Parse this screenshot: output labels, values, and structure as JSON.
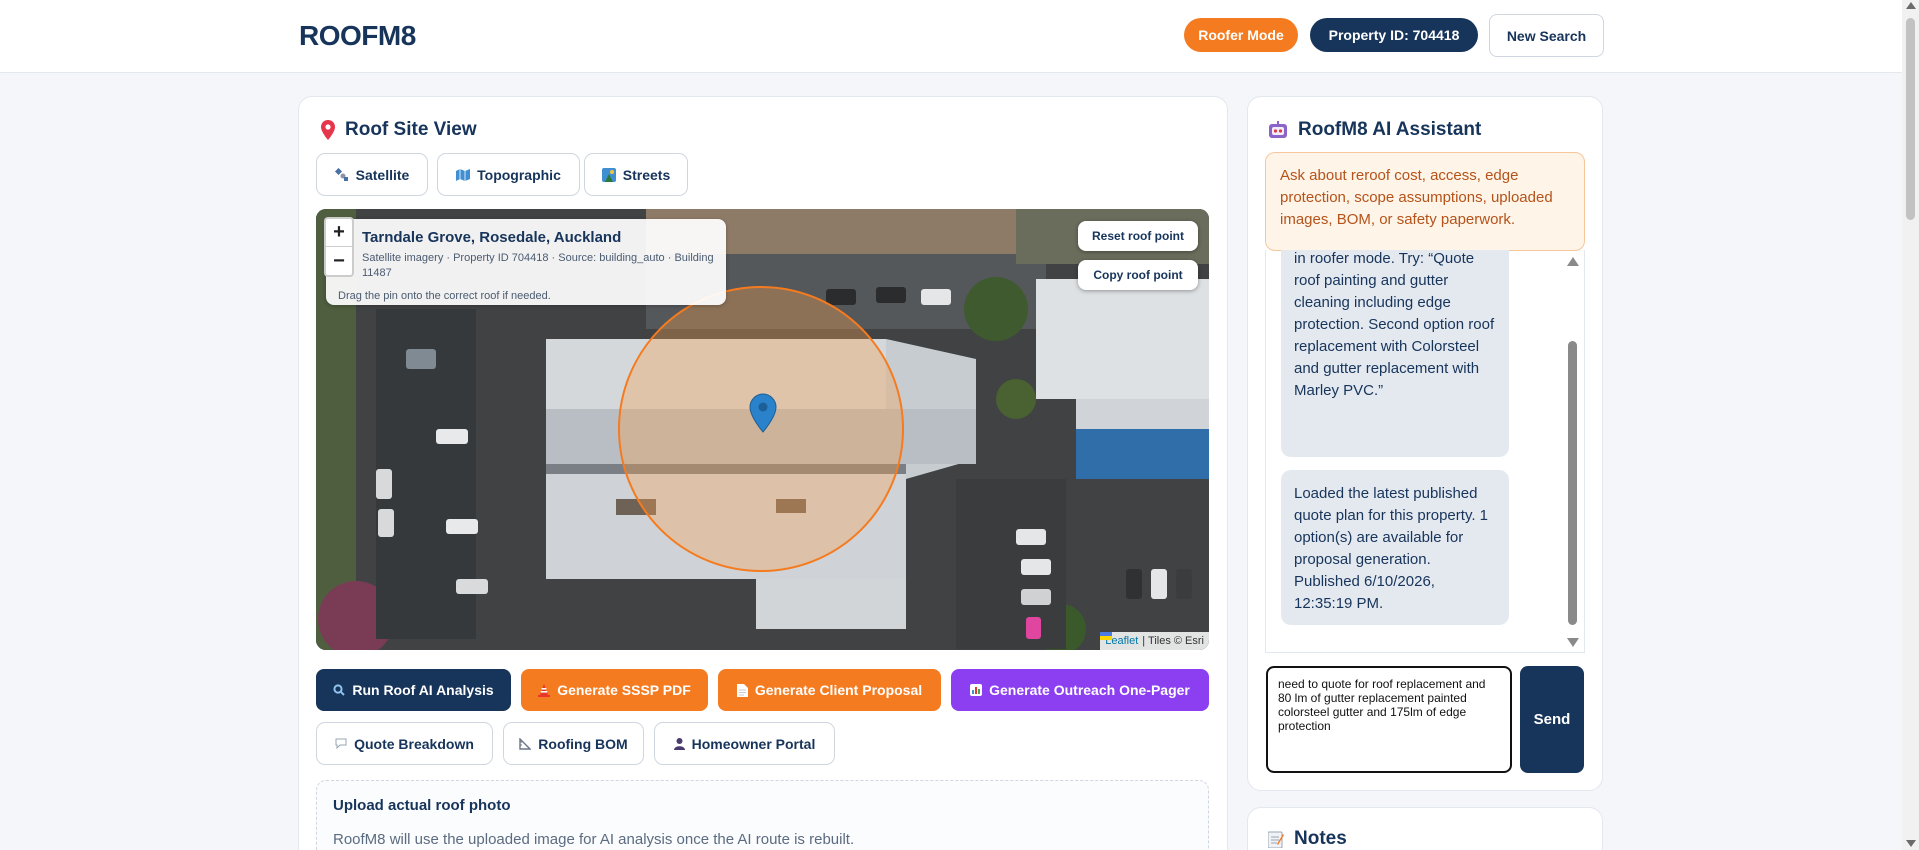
{
  "header": {
    "logo": "ROOFM8",
    "mode_badge": "Roofer Mode",
    "property_badge": "Property ID: 704418",
    "new_search_label": "New Search"
  },
  "site_view": {
    "title": "Roof Site View",
    "title_icon": "map-pin-icon",
    "tabs": [
      {
        "label": "Satellite",
        "icon": "satellite-icon"
      },
      {
        "label": "Topographic",
        "icon": "map-icon"
      },
      {
        "label": "Streets",
        "icon": "street-map-icon"
      }
    ],
    "map": {
      "address": "Tarndale Grove, Rosedale, Auckland",
      "meta": "Satellite imagery · Property ID 704418 · Source: building_auto · Building 11487",
      "hint": "Drag the pin onto the correct roof if needed.",
      "zoom_in": "+",
      "zoom_out": "−",
      "reset_label": "Reset roof point",
      "copy_label": "Copy roof point",
      "attribution_leaflet": "Leaflet",
      "attribution_tiles": "| Tiles © Esri"
    },
    "actions": [
      {
        "label": "Run Roof AI Analysis",
        "icon": "search-icon",
        "color": "#17345a"
      },
      {
        "label": "Generate SSSP PDF",
        "icon": "safety-cone-icon",
        "color": "#f47b20"
      },
      {
        "label": "Generate Client Proposal",
        "icon": "document-icon",
        "color": "#f47b20"
      },
      {
        "label": "Generate Outreach One-Pager",
        "icon": "chart-icon",
        "color": "#8b3ff0"
      }
    ],
    "secondary_actions": [
      {
        "label": "Quote Breakdown",
        "icon": "speech-bubble-icon"
      },
      {
        "label": "Roofing BOM",
        "icon": "ruler-icon"
      },
      {
        "label": "Homeowner Portal",
        "icon": "person-icon"
      }
    ],
    "upload": {
      "title": "Upload actual roof photo",
      "description": "RoofM8 will use the uploaded image for AI analysis once the AI route is rebuilt."
    }
  },
  "assistant": {
    "title": "RoofM8 AI Assistant",
    "title_icon": "robot-icon",
    "hint": "Ask about reroof cost, access, edge protection, scope assumptions, uploaded images, BOM, or safety paperwork.",
    "messages": [
      {
        "text": "in roofer mode. Try: “Quote roof painting and gutter cleaning including edge protection. Second option roof replacement with Colorsteel and gutter replacement with Marley PVC.”"
      },
      {
        "text": "Loaded the latest published quote plan for this property. 1 option(s) are available for proposal generation. Published 6/10/2026, 12:35:19 PM."
      }
    ],
    "input_value": "need to quote for roof replacement and 80 lm of gutter replacement painted colorsteel gutter and 175lm of edge protection",
    "send_label": "Send"
  },
  "notes": {
    "title": "Notes",
    "title_icon": "notepad-icon"
  },
  "colors": {
    "navy": "#17345a",
    "orange": "#f47b20",
    "purple": "#8b3ff0",
    "hint_bg": "#fff4e8"
  }
}
